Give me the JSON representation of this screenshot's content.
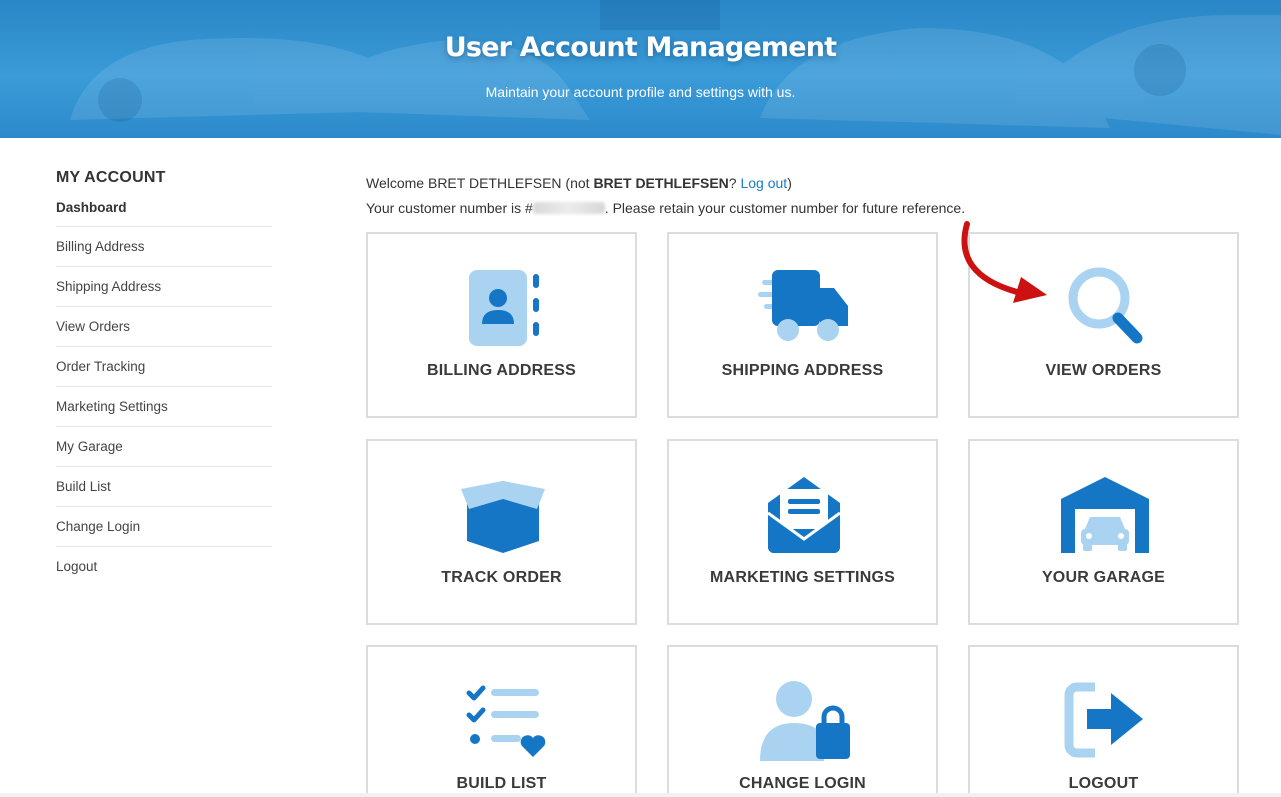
{
  "hero": {
    "title": "User Account Management",
    "subtitle": "Maintain your account profile and settings with us."
  },
  "sidebar": {
    "title": "MY ACCOUNT",
    "items": [
      {
        "label": "Dashboard",
        "active": true
      },
      {
        "label": "Billing Address"
      },
      {
        "label": "Shipping Address"
      },
      {
        "label": "View Orders"
      },
      {
        "label": "Order Tracking"
      },
      {
        "label": "Marketing Settings"
      },
      {
        "label": "My Garage"
      },
      {
        "label": "Build List"
      },
      {
        "label": "Change Login"
      },
      {
        "label": "Logout"
      }
    ]
  },
  "welcome": {
    "prefix": "Welcome BRET DETHLEFSEN (not ",
    "name": "BRET DETHLEFSEN",
    "question": "? ",
    "logout_link": "Log out",
    "suffix": ")",
    "customer_prefix": "Your customer number is #",
    "customer_suffix": ". Please retain your customer number for future reference."
  },
  "tiles": [
    {
      "label": "BILLING ADDRESS",
      "icon": "address-book-icon"
    },
    {
      "label": "SHIPPING ADDRESS",
      "icon": "delivery-truck-icon"
    },
    {
      "label": "VIEW ORDERS",
      "icon": "magnifier-icon"
    },
    {
      "label": "TRACK ORDER",
      "icon": "open-box-icon"
    },
    {
      "label": "MARKETING SETTINGS",
      "icon": "envelope-letter-icon"
    },
    {
      "label": "YOUR GARAGE",
      "icon": "garage-car-icon"
    },
    {
      "label": "BUILD LIST",
      "icon": "checklist-heart-icon"
    },
    {
      "label": "CHANGE LOGIN",
      "icon": "user-lock-icon"
    },
    {
      "label": "LOGOUT",
      "icon": "logout-arrow-icon"
    }
  ],
  "colors": {
    "brand_blue": "#1a7cc7",
    "icon_dark": "#1476c4",
    "icon_light": "#a9d3f0",
    "hero_blue": "#3a9bd8",
    "arrow_red": "#cc1111"
  }
}
